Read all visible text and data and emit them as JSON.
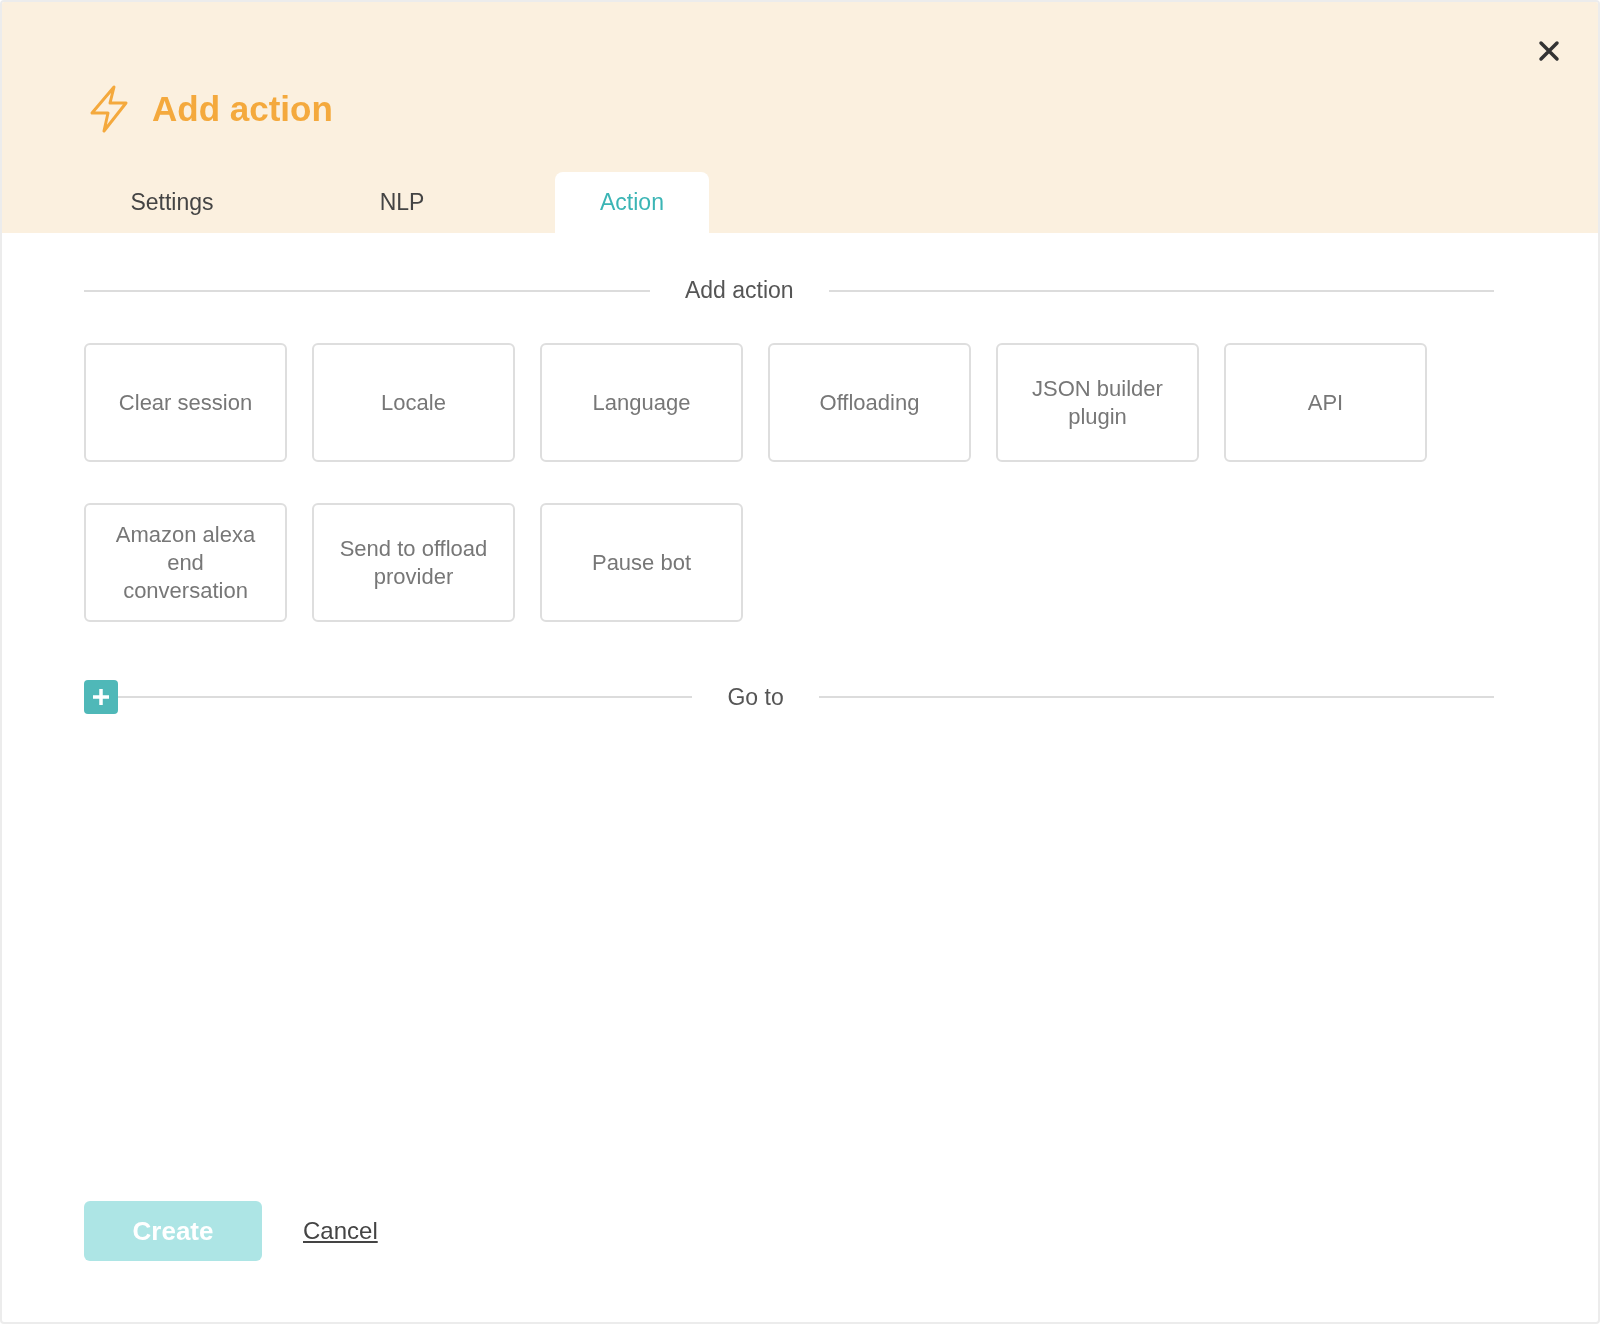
{
  "dialog": {
    "title": "Add action"
  },
  "tabs": [
    {
      "label": "Settings",
      "selected": false
    },
    {
      "label": "NLP",
      "selected": false
    },
    {
      "label": "Action",
      "selected": true
    }
  ],
  "add_action": {
    "heading": "Add action",
    "options": [
      "Clear session",
      "Locale",
      "Language",
      "Offloading",
      "JSON builder plugin",
      "API",
      "Amazon alexa end conversation",
      "Send to offload provider",
      "Pause bot"
    ]
  },
  "go_to": {
    "heading": "Go to"
  },
  "footer": {
    "create": {
      "label": "Create",
      "disabled": true
    },
    "cancel": {
      "label": "Cancel"
    }
  }
}
